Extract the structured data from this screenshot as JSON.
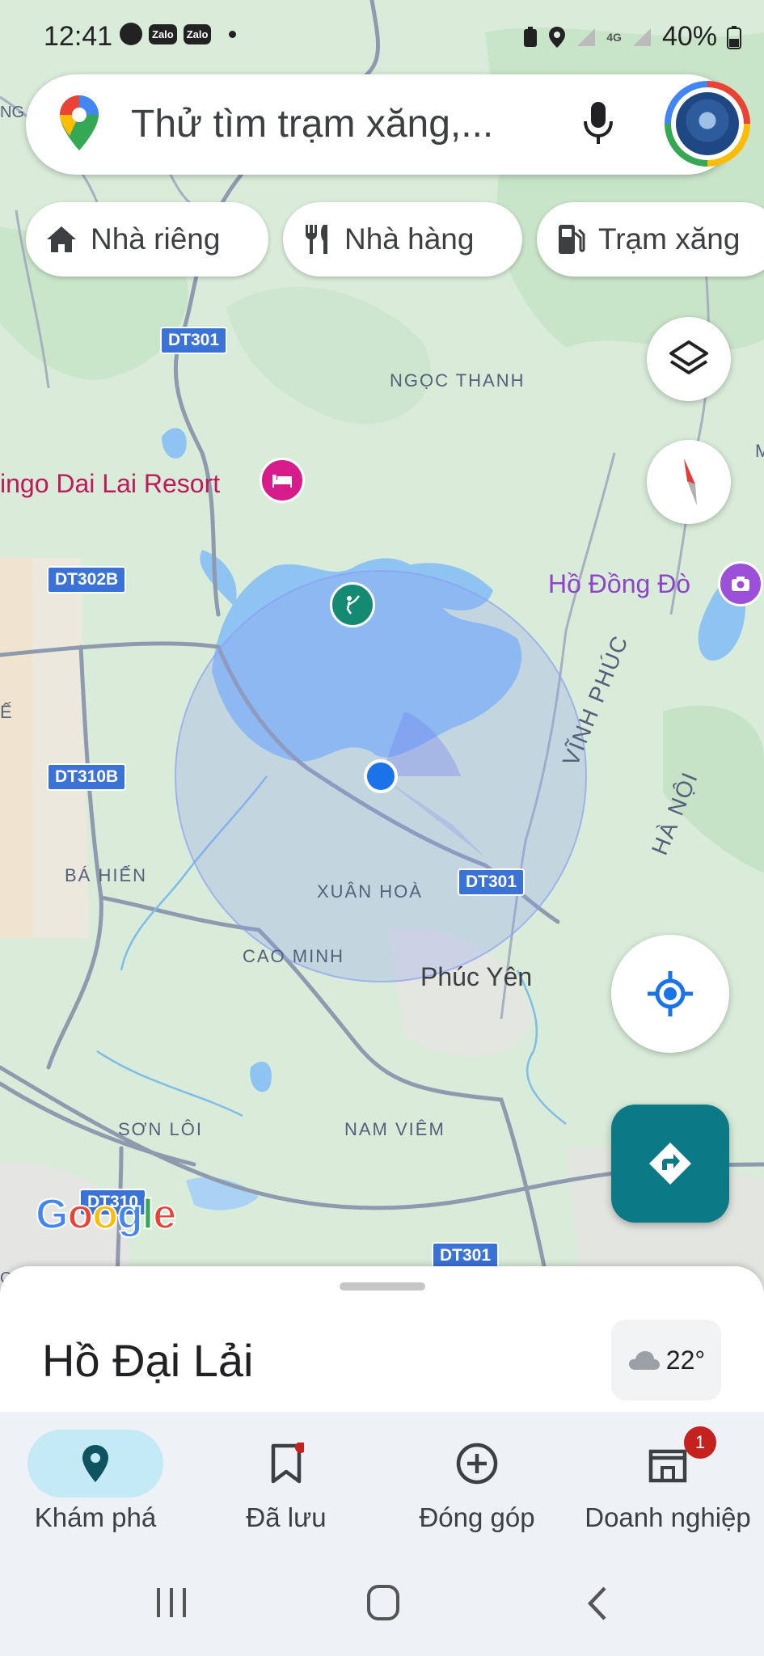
{
  "status_bar": {
    "time": "12:41",
    "app_icons": [
      "messenger-icon",
      "Zalo",
      "Zalo"
    ],
    "network": "4G",
    "battery": "40%"
  },
  "search": {
    "placeholder": "Thử tìm trạm xăng,..."
  },
  "chips": [
    {
      "label": "Nhà riêng",
      "icon": "home-icon"
    },
    {
      "label": "Nhà hàng",
      "icon": "restaurant-icon"
    },
    {
      "label": "Trạm xăng",
      "icon": "gas-station-icon"
    }
  ],
  "map": {
    "places": {
      "resort": "ingo Dai Lai Resort",
      "lake_poi": "Hồ Đồng Đò",
      "phuc_yen": "Phúc Yên",
      "ngoc_thanh": "NGỌC THANH",
      "xuan_hoa": "XUÂN HOÀ",
      "cao_minh": "CAO MINH",
      "ba_hien": "BÁ HIẾN",
      "son_loi": "SƠN LÔI",
      "nam_viem": "NAM VIÊM",
      "vinh_phuc": "VĨNH PHÚC",
      "ha_noi": "HÀ NỘI",
      "edge_ng": "NG",
      "edge_e": "Ế",
      "edge_m": "M",
      "edge_on": "ƠN"
    },
    "roads": {
      "dt301_a": "DT301",
      "dt301_b": "DT301",
      "dt301_c": "DT301",
      "dt302b": "DT302B",
      "dt310b": "DT310B",
      "dt310_partial": "DT310"
    },
    "logo": {
      "g1": "G",
      "o1": "o",
      "o2": "o",
      "g2": "g",
      "l": "l",
      "e": "e"
    }
  },
  "bottom_sheet": {
    "title": "Hồ Đại Lải",
    "weather_temp": "22°"
  },
  "bottom_nav": [
    {
      "label": "Khám phá",
      "icon": "explore-pin-icon",
      "active": true
    },
    {
      "label": "Đã lưu",
      "icon": "bookmark-icon",
      "active": false
    },
    {
      "label": "Đóng góp",
      "icon": "add-circle-icon",
      "active": false
    },
    {
      "label": "Doanh nghiệp",
      "icon": "store-icon",
      "active": false,
      "badge": "1"
    }
  ],
  "colors": {
    "accent": "#0b7a86",
    "location": "#1a73e8",
    "poi_pink": "#d81b8b",
    "poi_purple": "#9c4fd8",
    "water": "#8ec3f2",
    "land": "#dcefdc"
  }
}
